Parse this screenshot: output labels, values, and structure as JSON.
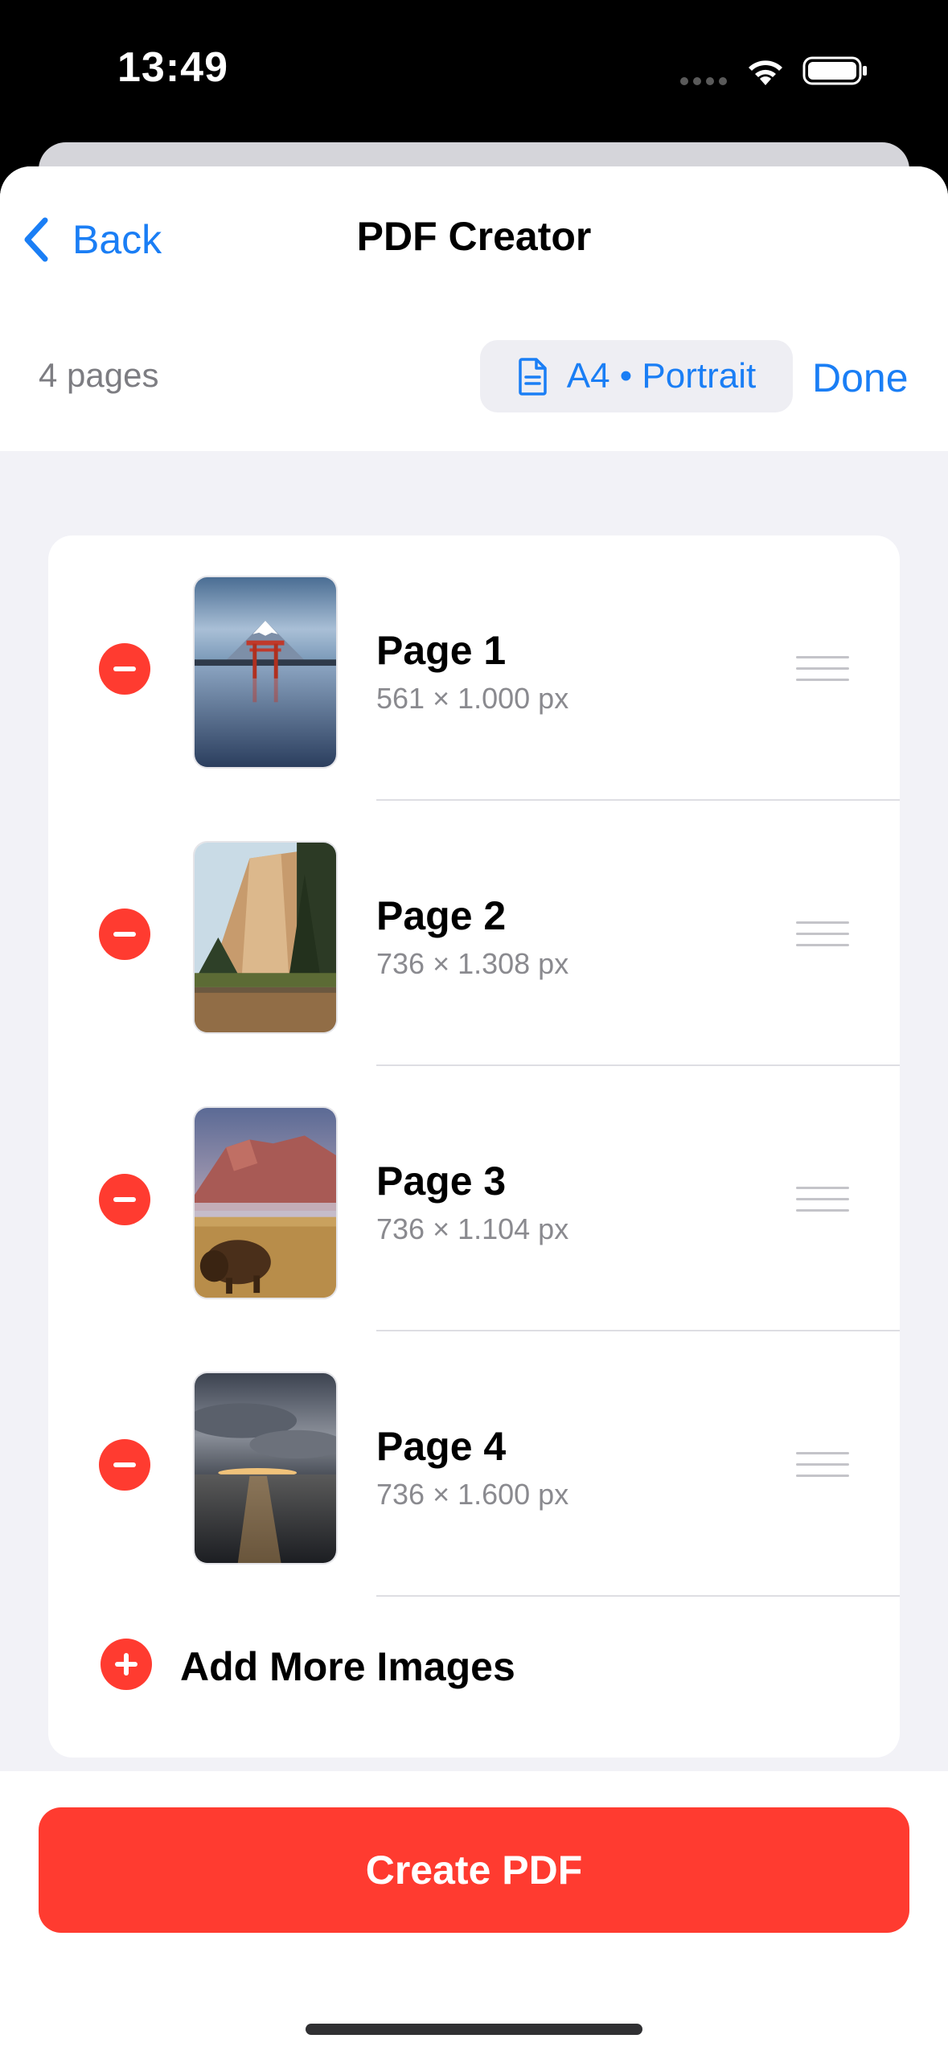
{
  "status_bar": {
    "time": "13:49",
    "icons": [
      "signal-dots-icon",
      "wifi-icon",
      "battery-icon"
    ]
  },
  "nav": {
    "back_label": "Back",
    "title": "PDF Creator"
  },
  "toolbar": {
    "page_count": "4 pages",
    "format_label": "A4 • Portrait",
    "format_icon": "document-icon",
    "done_label": "Done"
  },
  "pages": [
    {
      "title": "Page 1",
      "size": "561 × 1.000 px",
      "image": "torii-gate-mount-fuji-photo"
    },
    {
      "title": "Page 2",
      "size": "736 × 1.308 px",
      "image": "el-capitan-valley-photo"
    },
    {
      "title": "Page 3",
      "size": "736 × 1.104 px",
      "image": "bison-mountain-photo"
    },
    {
      "title": "Page 4",
      "size": "736 × 1.600 px",
      "image": "cloudy-sunset-shore-photo"
    }
  ],
  "add_more_label": "Add More Images",
  "create_button_label": "Create PDF",
  "colors": {
    "accent_blue": "#1a7ef5",
    "destructive_red": "#ff3b30",
    "grouped_background": "#f2f2f7"
  }
}
